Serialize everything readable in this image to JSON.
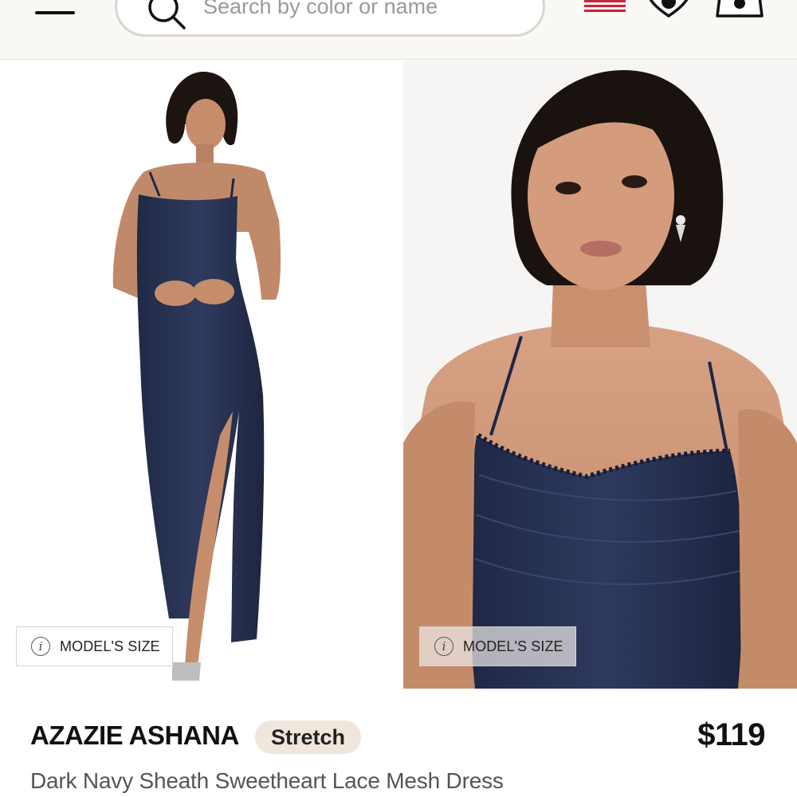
{
  "header": {
    "search_placeholder": "Search by color or name",
    "icons": {
      "menu": "hamburger-menu-icon",
      "search": "search-icon",
      "region": "us-flag-icon",
      "wishlist": "heart-icon",
      "cart": "shopping-bag-icon"
    }
  },
  "gallery": {
    "images": [
      {
        "description": "full-length-model-photo"
      },
      {
        "description": "close-up-model-photo"
      }
    ],
    "model_size_label": "MODEL'S SIZE"
  },
  "product": {
    "brand": "AZAZIE ASHANA",
    "badge": "Stretch",
    "price": "$119",
    "name": "Dark Navy Sheath Sweetheart Lace Mesh Dress"
  },
  "colors": {
    "dress": "#2b3556",
    "badge_bg": "#f1e6dc",
    "flag_red": "#c8233a"
  }
}
